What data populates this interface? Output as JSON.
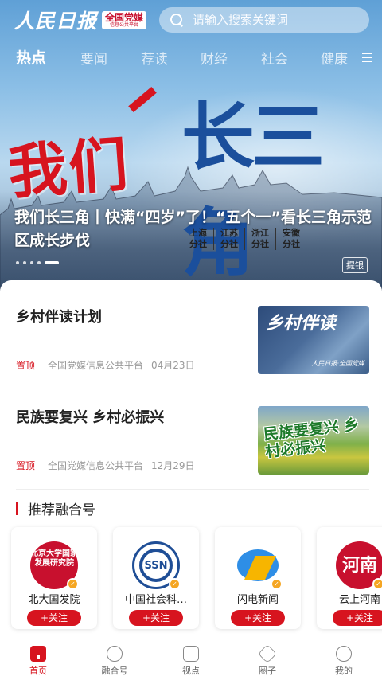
{
  "header": {
    "logo_main": "人民日报",
    "logo_badge_main": "全国党媒",
    "logo_badge_sub": "信息公共平台",
    "search_placeholder": "请输入搜索关键词"
  },
  "channels": [
    {
      "label": "热点",
      "active": true
    },
    {
      "label": "要闻"
    },
    {
      "label": "荐读"
    },
    {
      "label": "财经"
    },
    {
      "label": "社会"
    },
    {
      "label": "健康"
    }
  ],
  "hero": {
    "art_red": "我们",
    "art_blue": "长三角",
    "branches": [
      "上海\n分社",
      "江苏\n分社",
      "浙江\n分社",
      "安徽\n分社"
    ],
    "title": "我们长三角丨快满“四岁”了！“五个一”看长三角示范区成长步伐",
    "tag": "提银",
    "slide_count": 5,
    "active_slide": 5
  },
  "articles": [
    {
      "title": "乡村伴读计划",
      "pin": "置顶",
      "source": "全国党媒信息公共平台",
      "date": "04月23日",
      "thumb_text": "乡村伴读",
      "thumb_logo": "人民日报·全国党媒"
    },
    {
      "title": "民族要复兴 乡村必振兴",
      "pin": "置顶",
      "source": "全国党媒信息公共平台",
      "date": "12月29日",
      "thumb_text": "民族要复兴 乡村必振兴"
    }
  ],
  "recommend": {
    "title": "推荐融合号",
    "follow_label": "+关注",
    "accounts": [
      {
        "name": "北大国发院",
        "avatar_text": "北京大学国家发展研究院"
      },
      {
        "name": "中国社会科…",
        "avatar_text": "SSN"
      },
      {
        "name": "闪电新闻",
        "avatar_text": ""
      },
      {
        "name": "云上河南",
        "avatar_text": "河南"
      }
    ]
  },
  "tabbar": [
    {
      "label": "首页",
      "active": true
    },
    {
      "label": "融合号"
    },
    {
      "label": "视点"
    },
    {
      "label": "圈子"
    },
    {
      "label": "我的"
    }
  ],
  "colors": {
    "brand_red": "#d7141f",
    "brand_blue": "#1b4f9c"
  }
}
